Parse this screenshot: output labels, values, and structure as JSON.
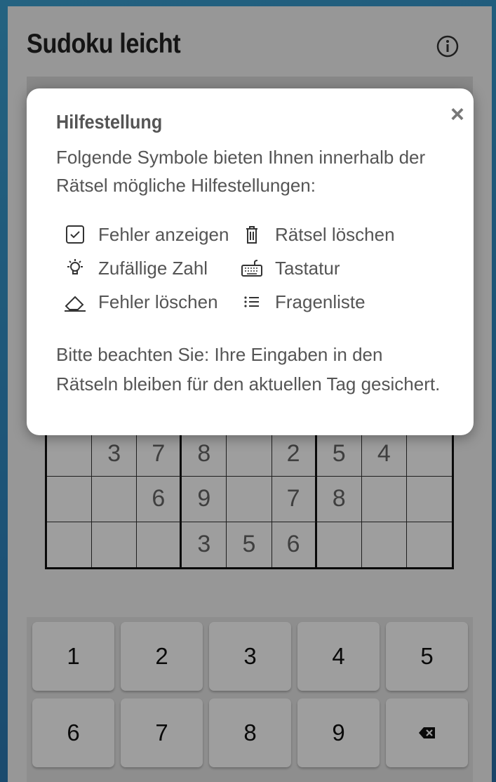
{
  "header": {
    "title": "Sudoku leicht"
  },
  "grid": {
    "rows": [
      [
        "",
        "",
        "",
        "",
        "",
        "",
        "",
        "",
        ""
      ],
      [
        "",
        "",
        "",
        "",
        "",
        "",
        "",
        "",
        ""
      ],
      [
        "",
        "",
        "",
        "",
        "",
        "",
        "",
        "",
        ""
      ],
      [
        "",
        "3",
        "7",
        "8",
        "",
        "2",
        "5",
        "4",
        ""
      ],
      [
        "",
        "",
        "6",
        "9",
        "",
        "7",
        "8",
        "",
        ""
      ],
      [
        "",
        "",
        "",
        "3",
        "5",
        "6",
        "",
        "",
        ""
      ]
    ]
  },
  "keypad": {
    "keys": [
      "1",
      "2",
      "3",
      "4",
      "5",
      "6",
      "7",
      "8",
      "9"
    ],
    "backspace_icon": "backspace-icon"
  },
  "modal": {
    "title": "Hilfestellung",
    "intro": "Folgende Symbole bieten Ihnen innerhalb der Rätsel mögliche Hilfestellungen:",
    "items": [
      {
        "icon": "checkbox-icon",
        "label": "Fehler anzeigen"
      },
      {
        "icon": "trash-icon",
        "label": "Rätsel löschen"
      },
      {
        "icon": "lightbulb-icon",
        "label": "Zufällige Zahl"
      },
      {
        "icon": "keyboard-icon",
        "label": "Tastatur"
      },
      {
        "icon": "eraser-icon",
        "label": "Fehler löschen"
      },
      {
        "icon": "list-icon",
        "label": "Fragenliste"
      }
    ],
    "note": "Bitte beachten Sie: Ihre Eingaben in den Rätseln bleiben für den aktuellen Tag gesichert.",
    "close_label": "×"
  },
  "colors": {
    "background": "#2f86bf",
    "overlay": "rgba(0,0,0,0.38)",
    "text": "#555555"
  }
}
